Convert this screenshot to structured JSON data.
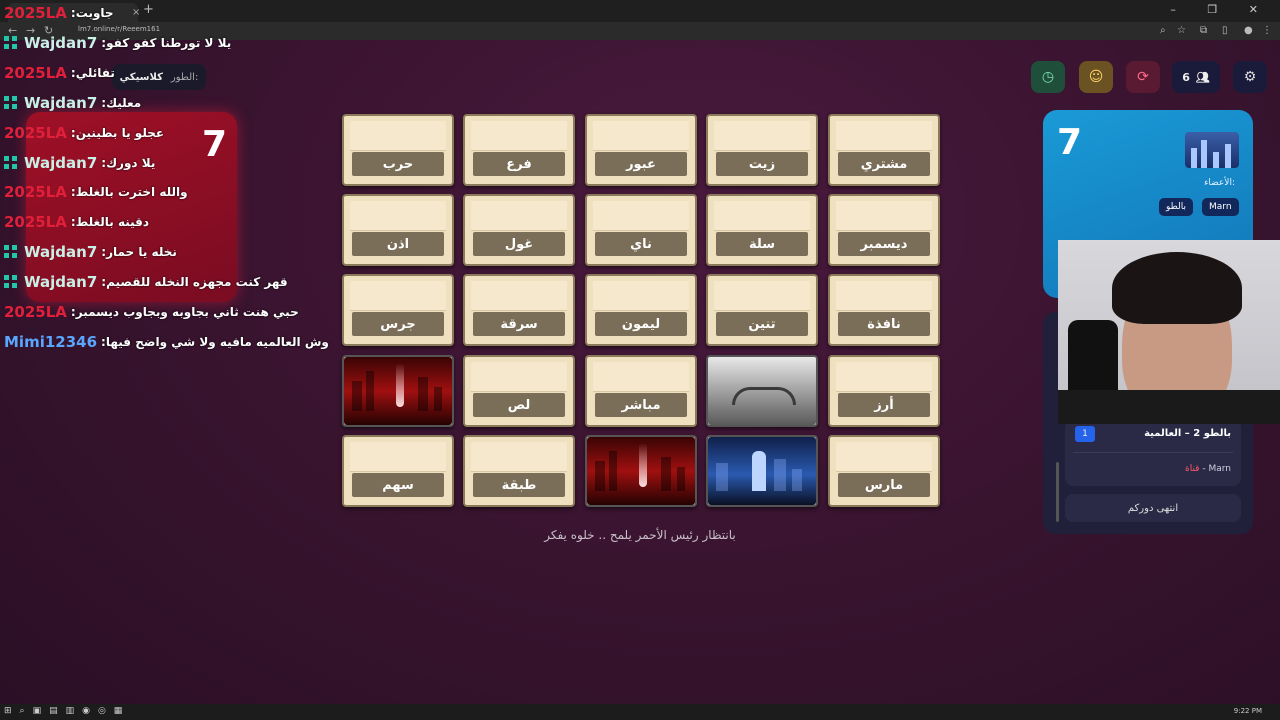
{
  "browser": {
    "url": "lm7.online/r/Reeem161",
    "tab_close": "×",
    "new_tab": "+",
    "window_controls": "–  ❐  ✕"
  },
  "chat": [
    {
      "user": "2025LA",
      "color": "red",
      "icon": false,
      "message": "جاوبت"
    },
    {
      "user": "Wajdan7",
      "color": "green",
      "icon": true,
      "message": "يلا لا تورطنا كفو كفو"
    },
    {
      "user": "2025LA",
      "color": "red",
      "icon": false,
      "message": "تفائلي"
    },
    {
      "user": "Wajdan7",
      "color": "green",
      "icon": true,
      "message": "معليك"
    },
    {
      "user": "2025LA",
      "color": "red",
      "icon": false,
      "message": "عجلو يا بطينين"
    },
    {
      "user": "Wajdan7",
      "color": "green",
      "icon": true,
      "message": "يلا دورك"
    },
    {
      "user": "2025LA",
      "color": "red",
      "icon": false,
      "message": "والله اخترت بالغلط"
    },
    {
      "user": "2025LA",
      "color": "red",
      "icon": false,
      "message": "دقينه بالغلط"
    },
    {
      "user": "Wajdan7",
      "color": "green",
      "icon": true,
      "message": "نخله يا حمار"
    },
    {
      "user": "Wajdan7",
      "color": "green",
      "icon": true,
      "message": "قهر كنت مجهزه النخله للقصيم"
    },
    {
      "user": "2025LA",
      "color": "red",
      "icon": false,
      "message": "حبي هنت ثاني بجاوبه وبجاوب ديسمبر"
    },
    {
      "user": "Mimi12346",
      "color": "blue",
      "icon": false,
      "message": "وش العالميه مافيه ولا شي واضح فيها"
    }
  ],
  "style_pill": {
    "label": "الطور:",
    "value": "كلاسيكي"
  },
  "red_team": {
    "score": "7",
    "color": "#e0203a"
  },
  "blue_team": {
    "score": "7",
    "color": "#1a9ad6",
    "members_label": "الأعضاء:",
    "members": [
      "Marn",
      "بالطو"
    ]
  },
  "top_buttons": {
    "players_count": "6",
    "timer_icon": "clock-icon",
    "emoji_icon": "emoji-icon",
    "refresh_icon": "refresh-icon",
    "settings_icon": "gear-icon"
  },
  "grid": [
    {
      "word": "مشتري",
      "image": null
    },
    {
      "word": "زيت",
      "image": null
    },
    {
      "word": "عبور",
      "image": null
    },
    {
      "word": "فرع",
      "image": null
    },
    {
      "word": "حرب",
      "image": null
    },
    {
      "word": "ديسمبر",
      "image": null
    },
    {
      "word": "سلة",
      "image": null
    },
    {
      "word": "ناي",
      "image": null
    },
    {
      "word": "غول",
      "image": null
    },
    {
      "word": "اذن",
      "image": null
    },
    {
      "word": "نافذة",
      "image": null
    },
    {
      "word": "تنين",
      "image": null
    },
    {
      "word": "ليمون",
      "image": null
    },
    {
      "word": "سرقة",
      "image": null
    },
    {
      "word": "جرس",
      "image": null
    },
    {
      "word": "أرز",
      "image": null
    },
    {
      "word": "",
      "image": "snow"
    },
    {
      "word": "مباشر",
      "image": null
    },
    {
      "word": "لص",
      "image": null
    },
    {
      "word": "",
      "image": "red"
    },
    {
      "word": "مارس",
      "image": null
    },
    {
      "word": "",
      "image": "blue"
    },
    {
      "word": "",
      "image": "red"
    },
    {
      "word": "طبقة",
      "image": null
    },
    {
      "word": "سهم",
      "image": null
    }
  ],
  "status_text": "بانتظار رئيس الأحمر يلمح .. خلوه يفكر",
  "log": {
    "entry_number": "1",
    "entry_title": "بالطو 2  –  العالمية",
    "entry_sub_name": "Marn",
    "entry_sub_sep": " - ",
    "entry_sub_role": "قناة",
    "end_turn": "انتهى دوركم"
  },
  "taskbar": {
    "time": "9:22 PM"
  }
}
